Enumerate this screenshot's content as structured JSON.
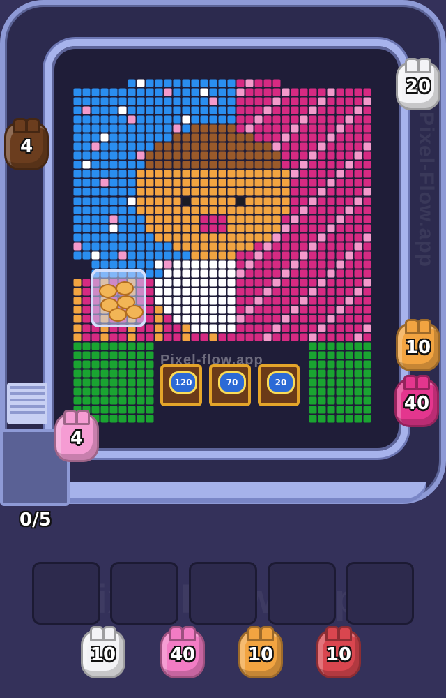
{
  "watermark": "Pixel-Flow.app",
  "board_watermark": "Pixel-flow.app",
  "counter": "0/5",
  "chests": [
    {
      "value": "120"
    },
    {
      "value": "70"
    },
    {
      "value": "20"
    }
  ],
  "track_pigs": [
    {
      "value": "20",
      "color": "#f3f3f6"
    },
    {
      "value": "4",
      "color": "#6b3d1e"
    },
    {
      "value": "10",
      "color": "#f2a441"
    },
    {
      "value": "40",
      "color": "#e4368e"
    },
    {
      "value": "4",
      "color": "#f59cd3"
    }
  ],
  "queue_pigs": [
    {
      "value": "10",
      "color": "#f3f3f6"
    },
    {
      "value": "40",
      "color": "#f27cc4"
    },
    {
      "value": "10",
      "color": "#f2a441"
    },
    {
      "value": "10",
      "color": "#d9464f"
    }
  ],
  "palette": {
    "blue": "#2a8ef0",
    "pink": "#f49acb",
    "magenta": "#d62a82",
    "orange": "#f2a441",
    "brown": "#9a5a2a",
    "white": "#ffffff",
    "green": "#1aa431",
    "black": "#1c1c24"
  }
}
